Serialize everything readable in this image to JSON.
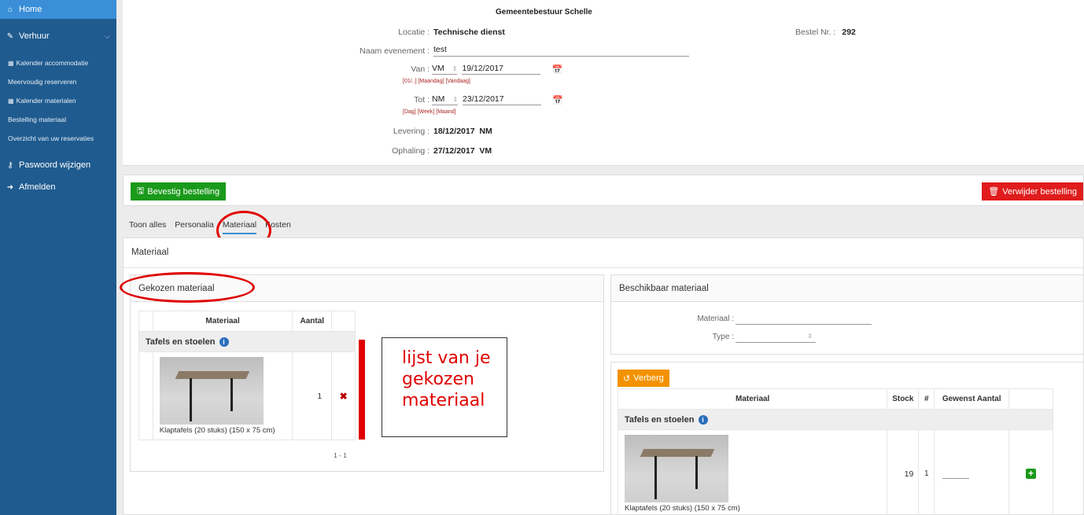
{
  "sidebar": {
    "home": "Home",
    "verhuur": "Verhuur",
    "subitems": [
      "Kalender accommodatie",
      "Meervoudig reserveren",
      "Kalender materialen",
      "Bestelling materiaal",
      "Overzicht van uw reservaties"
    ],
    "password": "Paswoord wijzigen",
    "logout": "Afmelden"
  },
  "order": {
    "org": "Gemeentebestuur Schelle",
    "locatie_label": "Locatie :",
    "locatie": "Technische dienst",
    "bestel_label": "Bestel Nr. :",
    "bestel_nr": "292",
    "naam_label": "Naam evenement :",
    "naam": "test",
    "van_label": "Van :",
    "van_part": "VM",
    "van_date": "19/12/2017",
    "van_hint": "[01/..] [Maandag] [Vandaag]",
    "tot_label": "Tot :",
    "tot_part": "NM",
    "tot_date": "23/12/2017",
    "tot_hint": "[Dag] [Week] [Maand]",
    "levering_label": "Levering :",
    "levering": "18/12/2017  NM",
    "ophaling_label": "Ophaling :",
    "ophaling": "27/12/2017  VM"
  },
  "actions": {
    "confirm": "Bevestig bestelling",
    "delete": "Verwijder bestelling"
  },
  "tabs": [
    "Toon alles",
    "Personalia",
    "Materiaal",
    "Kosten"
  ],
  "section_title": "Materiaal",
  "chosen": {
    "title": "Gekozen materiaal",
    "col_material": "Materiaal",
    "col_amount": "Aantal",
    "group": "Tafels en stoelen",
    "item_name": "Klaptafels (20 stuks) (150 x 75 cm)",
    "item_amount": "1",
    "pager": "1 - 1"
  },
  "callout_text": [
    "lijst van je",
    "gekozen",
    "materiaal"
  ],
  "available": {
    "title": "Beschikbaar materiaal",
    "filter_material_label": "Materiaal :",
    "filter_type_label": "Type :",
    "hide_button": "Verberg",
    "col_material": "Materiaal",
    "col_stock": "Stock",
    "col_hash": "#",
    "col_wanted": "Gewenst Aantal",
    "group": "Tafels en stoelen",
    "item_name": "Klaptafels (20 stuks) (150 x 75 cm)",
    "item_stock": "19",
    "item_hash": "1"
  }
}
